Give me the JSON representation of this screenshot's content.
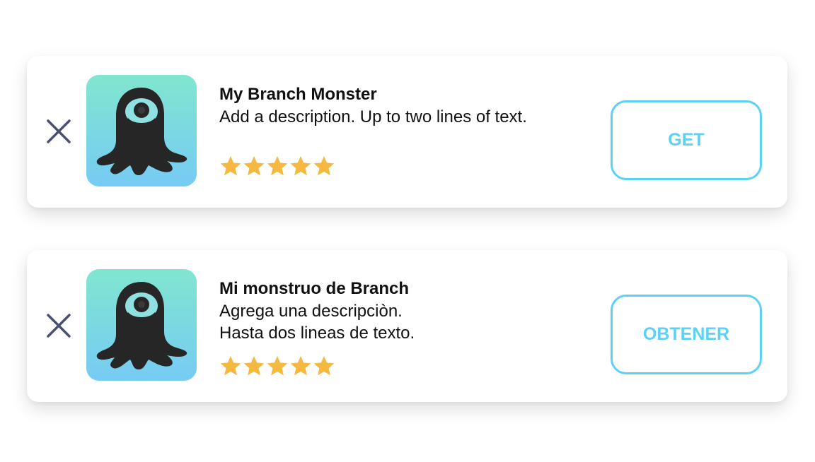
{
  "banners": [
    {
      "title": "My Branch Monster",
      "description_lines": [
        "Add a description.  Up to two lines of text."
      ],
      "rating_stars": 5,
      "cta_label": "GET",
      "icon": "monster-app-icon"
    },
    {
      "title": "Mi monstruo de Branch",
      "description_lines": [
        "Agrega una descripciòn.",
        "Hasta dos lineas de texto."
      ],
      "rating_stars": 5,
      "cta_label": "OBTENER",
      "icon": "monster-app-icon"
    }
  ],
  "colors": {
    "accent": "#5bd2f5",
    "star": "#f5b841",
    "close_icon": "#4a5070",
    "icon_gradient_top": "#80e6cf",
    "icon_gradient_bottom": "#76cbf4",
    "monster": "#262626"
  }
}
